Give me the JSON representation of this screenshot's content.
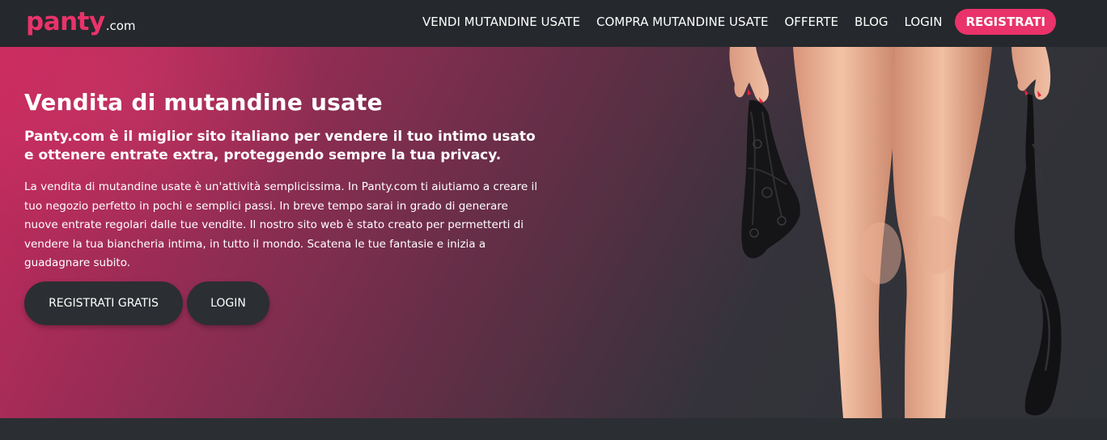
{
  "brand": {
    "logo_main": "panty",
    "logo_suffix": ".com",
    "accent_color": "#e9336a",
    "dark_color": "#2b2e32"
  },
  "nav": {
    "items": [
      {
        "label": "VENDI MUTANDINE USATE"
      },
      {
        "label": "COMPRA MUTANDINE USATE"
      },
      {
        "label": "OFFERTE"
      },
      {
        "label": "BLOG"
      },
      {
        "label": "LOGIN"
      }
    ],
    "cta_label": "REGISTRATI"
  },
  "hero": {
    "title": "Vendita di mutandine usate",
    "subtitle": "Panty.com è il miglior sito italiano per vendere il tuo intimo usato e ottenere entrate extra, proteggendo sempre la tua privacy.",
    "body": "La vendita di mutandine usate è un'attività semplicissima. In Panty.com ti aiutiamo a creare il tuo negozio perfetto in pochi e semplici passi. In breve tempo sarai in grado di generare nuove entrate regolari dalle tue vendite. Il nostro sito web è stato creato per permetterti di vendere la tua biancheria intima, in tutto il mondo. Scatena le tue fantasie e inizia a guadagnare subito.",
    "primary_button": "REGISTRATI GRATIS",
    "secondary_button": "LOGIN"
  }
}
